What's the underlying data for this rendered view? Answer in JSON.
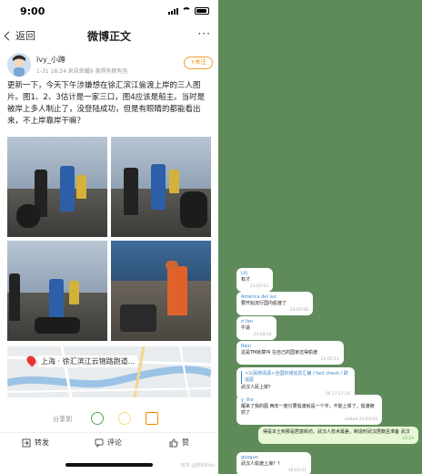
{
  "status_bar": {
    "time": "9:00"
  },
  "nav": {
    "back_label": "返回",
    "title": "微博正文",
    "more": "···"
  },
  "author": {
    "name": "Ivy_小蹲",
    "meta": "1-31 18:24  来自荣耀9 美得有颜有色",
    "follow_label": "+关注"
  },
  "post": {
    "text": "更新一下，今天下午涉嫌想在徐汇滨江偷渡上岸的三人图片。图1、2、3估计是一家三口，图4应该是船主。当时是被岸上多人制止了，没登陆成功，但是有眼睛的都能看出来，不上岸靠岸干嘛？"
  },
  "map": {
    "label": "上海 · 徐汇滨江云锦路跑道..."
  },
  "actions": {
    "share_label": "分享到"
  },
  "bottom_bar": {
    "repost": "转发",
    "comment": "评论",
    "like": "赞"
  },
  "watermark": "知乎 @野狗Kids",
  "colors": {
    "accent_orange": "#f08a00",
    "chat_bg": "#5f8b5b",
    "link_blue": "#3a86c8",
    "out_bubble": "#e8f8d6"
  },
  "chat": {
    "messages": [
      {
        "sender": "Lilj",
        "text": "有才",
        "time": "23:03:53"
      },
      {
        "sender": "América del sur",
        "text": "要开始流行国内偷渡了",
        "time": "23:03:58"
      },
      {
        "sender": "ri fan",
        "text": "牛逼",
        "time": "23:04:01"
      },
      {
        "sender": "Rain",
        "text": "这是TM就算叫 在自己的国家还得偷渡",
        "time": "23:05:11"
      },
      {
        "sender": "<公民新闻源>全国封城信息汇编 / fact check / 辟谣驱",
        "text": "武汉人民上岸？",
        "time": "16  17:17:18"
      },
      {
        "sender": "y_tho",
        "text": "醒来了我的图 两年一度只要偷渡就是一个字，不能上岸了，偷渡被抓了",
        "time": "edited 23:03:03"
      },
      {
        "sender": "",
        "text": "得是本土到那是居富街坊，武汉人技术最差，制造时武汉居籍且准备 武汉",
        "time": "13:23"
      },
      {
        "sender": "guoguo",
        "text": "武汉人偷渡上海？？",
        "time": "19:03:51"
      }
    ]
  }
}
